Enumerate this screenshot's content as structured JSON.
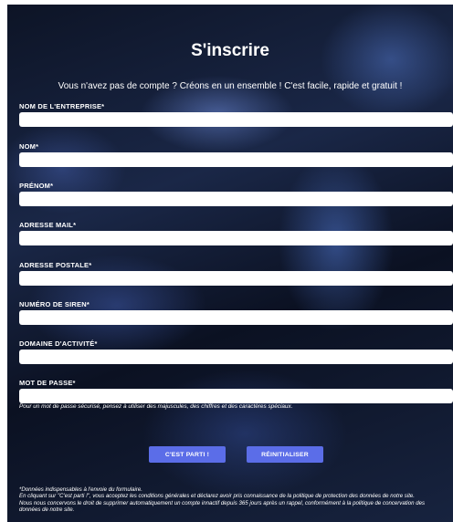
{
  "form": {
    "title": "S'inscrire",
    "subtitle": "Vous n'avez pas de compte ? Créons en un ensemble ! C'est facile, rapide et gratuit !",
    "fields": [
      {
        "label": "NOM DE L'ENTREPRISE*",
        "value": ""
      },
      {
        "label": "NOM*",
        "value": ""
      },
      {
        "label": "PRÉNOM*",
        "value": ""
      },
      {
        "label": "ADRESSE MAIL*",
        "value": ""
      },
      {
        "label": "ADRESSE POSTALE*",
        "value": ""
      },
      {
        "label": "NUMÉRO DE SIREN*",
        "value": ""
      },
      {
        "label": "DOMAINE D'ACTIVITÉ*",
        "value": ""
      },
      {
        "label": "MOT DE PASSE*",
        "value": ""
      }
    ],
    "password_hint": "Pour un mot de passe sécurisé, pensez à utiliser des majuscules, des chiffres et des caractères spéciaux.",
    "submit_label": "C'EST PARTI !",
    "reset_label": "RÉINITIALISER",
    "footer": {
      "line1": "*Données indispensables à l'envoie du formulaire.",
      "line2": "En cliquant sur \"C'est parti !\", vous acceptez les conditions générales et déclarez avoir pris connaissance de la politique de protection des données de notre site.",
      "line3": "Nous nous concervons le droit de supprimer automatiquement un compte innactif depuis 365 jours après un rappel, conformément à la politique de concervation des données de notre site."
    }
  }
}
